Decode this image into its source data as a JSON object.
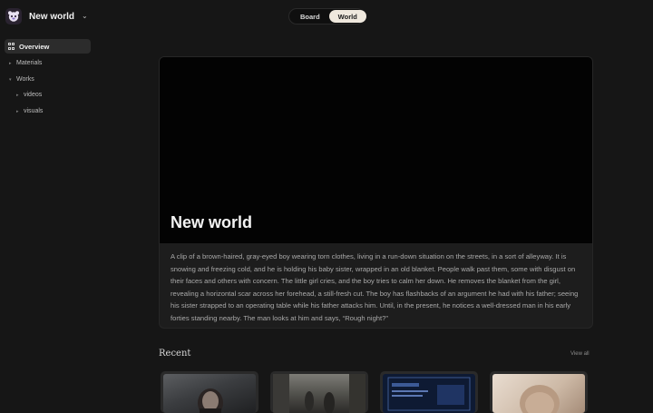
{
  "workspace": {
    "name": "New world",
    "logo_icon": "bear-logo-icon"
  },
  "view_switch": {
    "options": [
      "Board",
      "World"
    ],
    "active": "World"
  },
  "sidebar": {
    "overview": "Overview",
    "items": [
      {
        "label": "Materials",
        "level": 0
      },
      {
        "label": "Works",
        "level": 0
      },
      {
        "label": "videos",
        "level": 1
      },
      {
        "label": "visuals",
        "level": 1
      }
    ]
  },
  "hero": {
    "title": "New world",
    "description": "A clip of a brown-haired, gray-eyed boy wearing torn clothes, living in a run-down situation on the streets, in a sort of alleyway. It is snowing and freezing cold, and he is holding his baby sister, wrapped in an old blanket. People walk past them, some with disgust on their faces and others with concern. The little girl cries, and the boy tries to calm her down. He removes the blanket from the girl, revealing a horizontal scar across her forehead, a still-fresh cut. The boy has flashbacks of an argument he had with his father; seeing his sister strapped to an operating table while his father attacks him. Until, in the present, he notices a well-dressed man in his early forties standing nearby. The man looks at him and says, “Rough night?”"
  },
  "recent": {
    "heading": "Recent",
    "view_all": "View all",
    "thumbnails": [
      {
        "name": "thumbnail-boy-street"
      },
      {
        "name": "thumbnail-alley-crowd"
      },
      {
        "name": "thumbnail-screen-interface"
      },
      {
        "name": "thumbnail-baby"
      }
    ]
  },
  "colors": {
    "background": "#161616",
    "accent_pill": "#efe8dd",
    "card": "#1d1d1d"
  }
}
